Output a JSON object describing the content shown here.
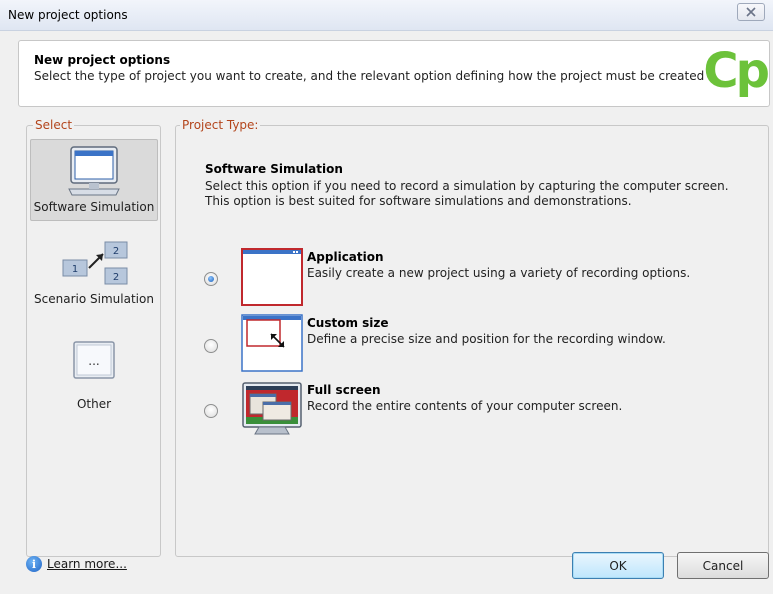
{
  "window": {
    "title": "New project options"
  },
  "header": {
    "title": "New project options",
    "description": "Select the type of project you want to create, and the relevant option defining how the project must be created",
    "logo_text": "Cp",
    "logo_color": "#6cc23a"
  },
  "select": {
    "legend": "Select",
    "items": [
      {
        "label": "Software Simulation",
        "icon": "monitor-icon",
        "selected": true
      },
      {
        "label": "Scenario Simulation",
        "icon": "scenario-icon",
        "selected": false
      },
      {
        "label": "Other",
        "icon": "other-icon",
        "selected": false
      }
    ]
  },
  "project_type": {
    "legend": "Project Type:",
    "section_title": "Software Simulation",
    "section_description": "Select this option if you need to record a simulation by capturing the computer screen. This option is best suited for software simulations and demonstrations.",
    "options": [
      {
        "title": "Application",
        "description": "Easily create a new project using a variety of recording options.",
        "icon": "application-window-icon",
        "checked": true
      },
      {
        "title": "Custom size",
        "description": "Define a precise size and position for the recording window.",
        "icon": "custom-size-icon",
        "checked": false
      },
      {
        "title": "Full screen",
        "description": "Record the entire contents of your computer screen.",
        "icon": "full-screen-icon",
        "checked": false
      }
    ]
  },
  "footer": {
    "learn_more": "Learn more...",
    "ok_label": "OK",
    "cancel_label": "Cancel"
  },
  "colors": {
    "accent": "#b3451c",
    "selection": "#dadada",
    "frame_red": "#c0282d"
  }
}
